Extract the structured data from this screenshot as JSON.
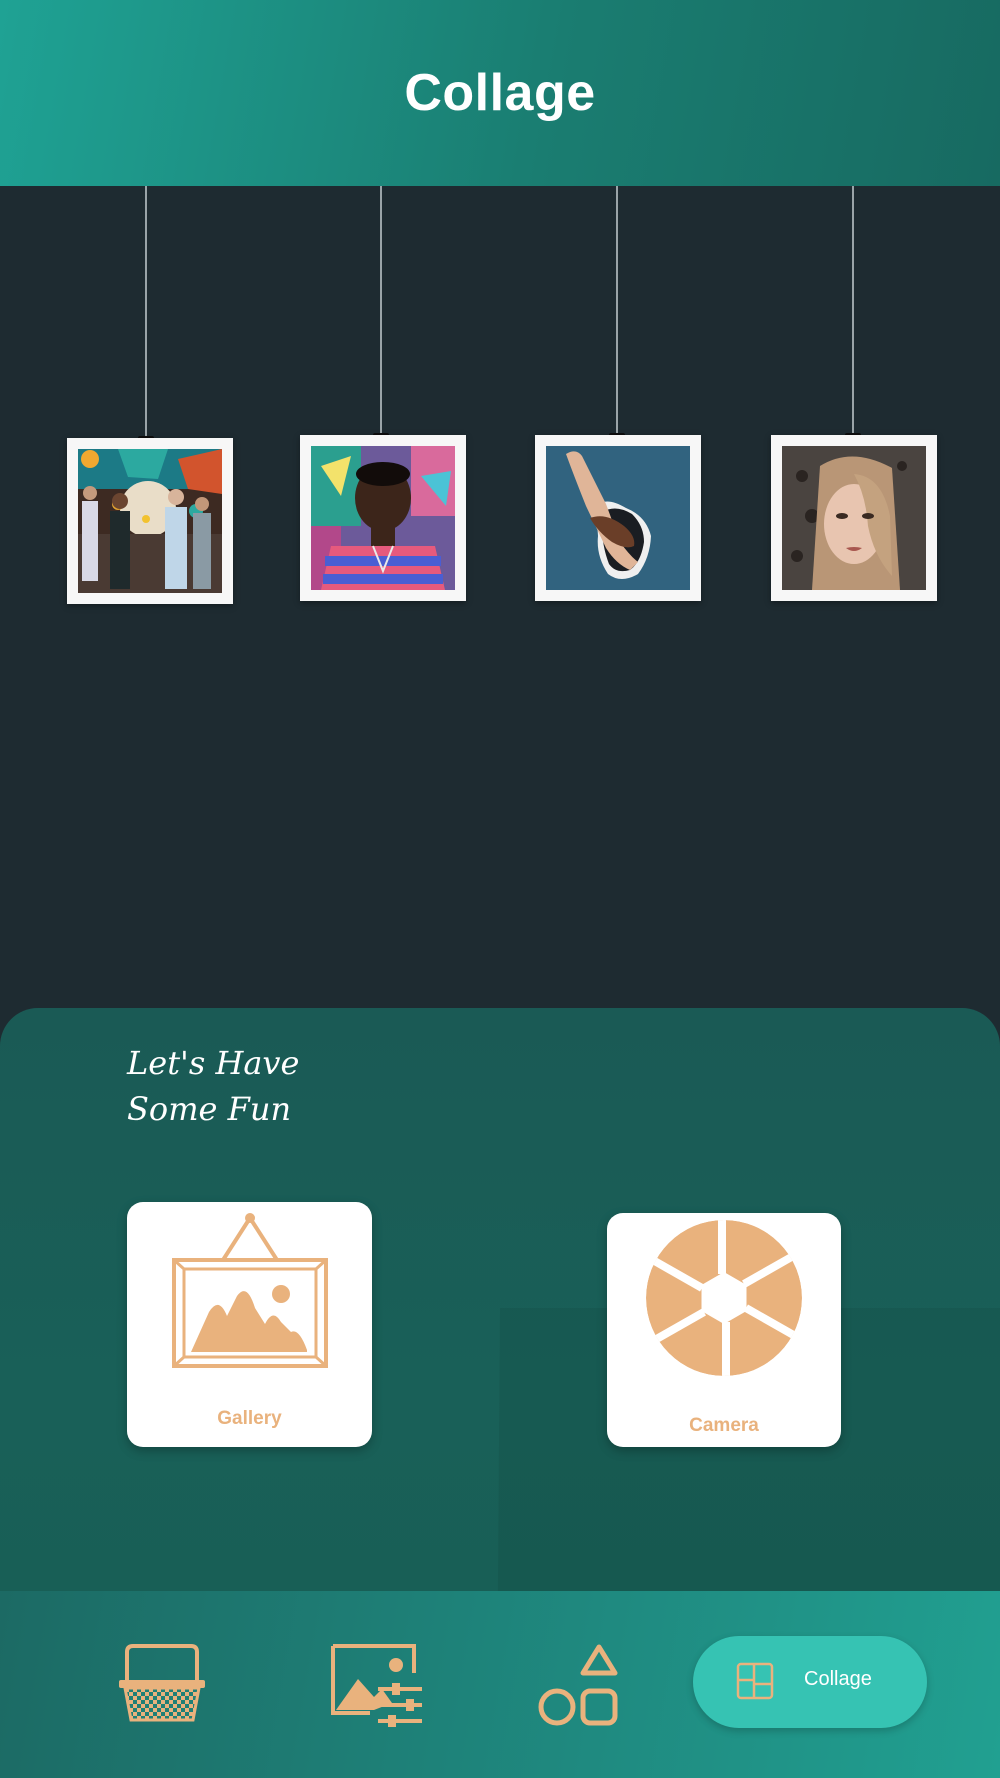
{
  "header": {
    "title": "Collage"
  },
  "photos": [
    {
      "icon": "group-photo-thumbnail"
    },
    {
      "icon": "man-portrait-thumbnail"
    },
    {
      "icon": "hand-photo-thumbnail"
    },
    {
      "icon": "woman-portrait-thumbnail"
    }
  ],
  "panel": {
    "line1": "Let's Have",
    "line2": "Some Fun",
    "gallery_label": "Gallery",
    "camera_label": "Camera"
  },
  "nav": {
    "items": [
      {
        "icon": "basket-icon"
      },
      {
        "icon": "image-adjust-icon"
      },
      {
        "icon": "shapes-icon"
      },
      {
        "icon": "collage-icon",
        "label": "Collage"
      }
    ]
  },
  "colors": {
    "accent": "#e9b27d",
    "header": "#1fa294",
    "wall": "#1e2b31",
    "panel": "#1a5a55",
    "active_pill": "#36c3b3"
  }
}
